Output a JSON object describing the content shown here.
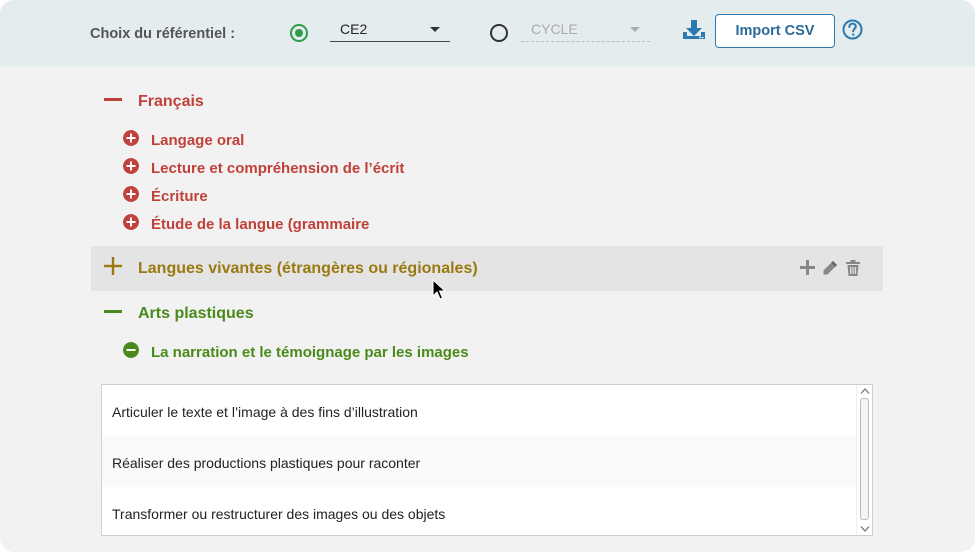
{
  "topbar": {
    "ref_label": "Choix du référentiel :",
    "option_level": {
      "value": "CE2",
      "selected": true
    },
    "option_cycle": {
      "value": "CYCLE",
      "selected": false
    },
    "import_label": "Import CSV",
    "icons": {
      "download": "download-icon",
      "help": "help-icon"
    }
  },
  "sections": [
    {
      "title": "Français",
      "color": "#c0413a",
      "expanded": true,
      "items": [
        "Langage oral",
        "Lecture et compréhension de l’écrit",
        "Écriture",
        "Étude de la langue (grammaire"
      ]
    },
    {
      "title": "Langues vivantes (étrangères ou régionales)",
      "color": "#9a7a10",
      "expanded": false,
      "actions": [
        "plus-icon",
        "pencil-icon",
        "trash-icon"
      ]
    },
    {
      "title": "Arts plastiques",
      "color": "#4a8a1a",
      "expanded": true,
      "items": [
        "La narration et le témoignage par les images"
      ]
    }
  ],
  "list": {
    "rows": [
      "Articuler le texte et l’image à des fins d’illustration",
      "Réaliser des productions plastiques pour raconter",
      "Transformer ou restructurer des images ou des objets"
    ]
  }
}
